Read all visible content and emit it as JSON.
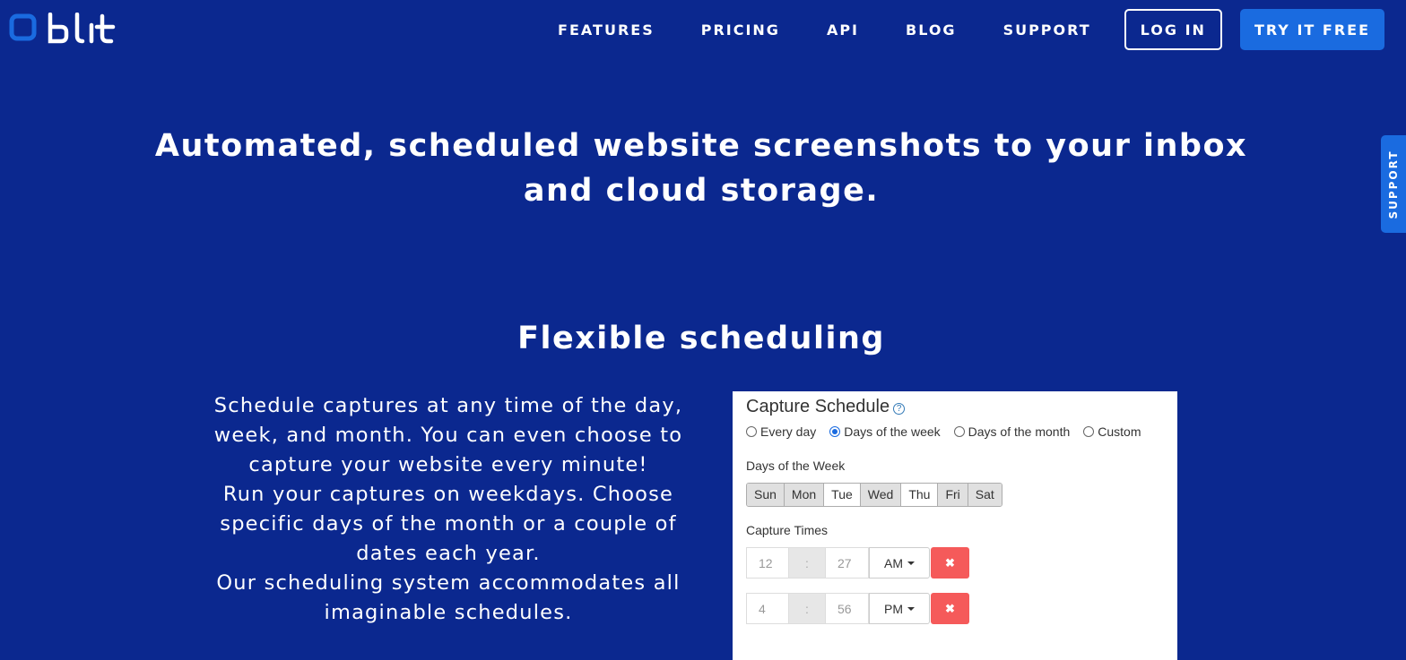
{
  "brand": {
    "logo_text": "blit",
    "accent": "#1a6be0",
    "background": "#0b288f"
  },
  "nav": {
    "links": [
      "FEATURES",
      "PRICING",
      "API",
      "BLOG",
      "SUPPORT"
    ],
    "login": "LOG IN",
    "try_free": "TRY IT FREE"
  },
  "support_tab": "SUPPORT",
  "hero": {
    "line1": "Automated, scheduled website screenshots to your inbox",
    "line2": "and cloud storage."
  },
  "section": {
    "title": "Flexible scheduling",
    "description": [
      "Schedule captures at any time of the day, week, and month. You can even choose to capture your website every minute!",
      "Run your captures on weekdays. Choose specific days of the month or a couple of dates each year.",
      "Our scheduling system accommodates all imaginable schedules."
    ]
  },
  "schedule": {
    "title": "Capture Schedule",
    "help_icon": "?",
    "options": [
      {
        "label": "Every day",
        "checked": false
      },
      {
        "label": "Days of the week",
        "checked": true
      },
      {
        "label": "Days of the month",
        "checked": false
      },
      {
        "label": "Custom",
        "checked": false
      }
    ],
    "days_label": "Days of the Week",
    "days": [
      {
        "label": "Sun",
        "selected": true
      },
      {
        "label": "Mon",
        "selected": true
      },
      {
        "label": "Tue",
        "selected": false
      },
      {
        "label": "Wed",
        "selected": true
      },
      {
        "label": "Thu",
        "selected": false
      },
      {
        "label": "Fri",
        "selected": true
      },
      {
        "label": "Sat",
        "selected": true
      }
    ],
    "times_label": "Capture Times",
    "separator": ":",
    "delete_icon": "✖",
    "times": [
      {
        "hour": "12",
        "minute": "27",
        "period": "AM"
      },
      {
        "hour": "4",
        "minute": "56",
        "period": "PM"
      }
    ]
  }
}
